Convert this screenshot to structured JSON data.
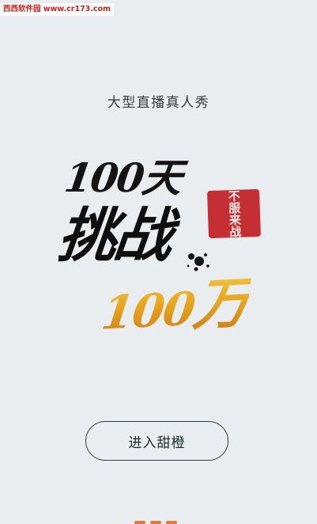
{
  "watermark": {
    "text": "西西软件园 www.cr173.com"
  },
  "subtitle": "大型直播真人秀",
  "hero": {
    "line1": "100天",
    "line2": "挑战",
    "gold_number": "100",
    "gold_char": "万",
    "seal_text": "不服来战",
    "colors": {
      "ink": "#141414",
      "gold_top": "#f4c640",
      "gold_bottom": "#c8781b",
      "seal": "#c21f25"
    }
  },
  "enter_button": {
    "label": "进入甜橙"
  },
  "colors": {
    "background": "#e9edef",
    "button_border": "#2c3d45"
  }
}
